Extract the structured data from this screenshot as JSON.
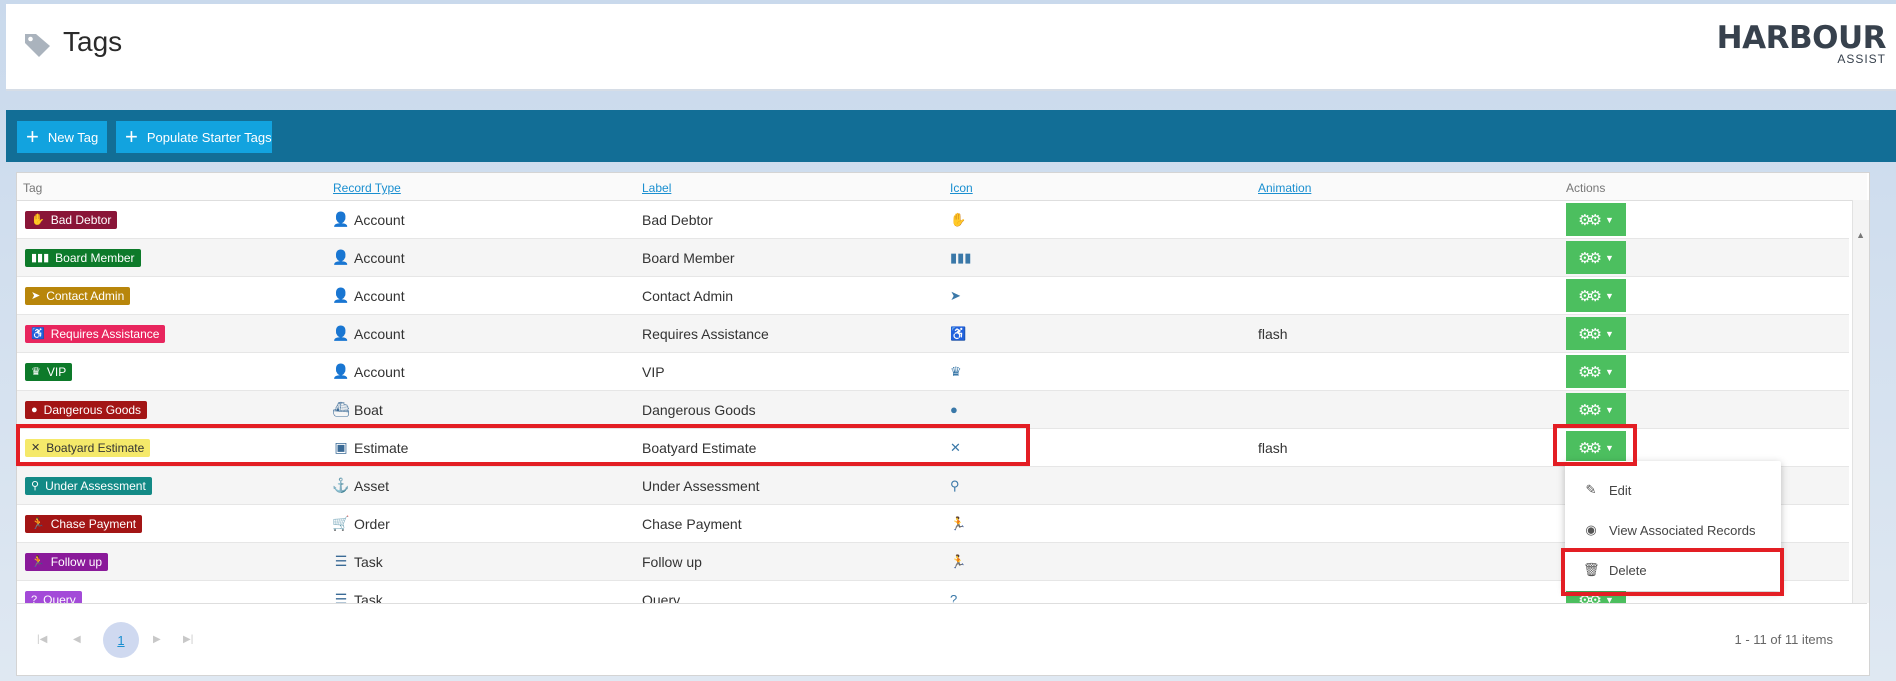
{
  "header": {
    "title": "Tags",
    "logo_main": "HARBOUR",
    "logo_sub": "ASSIST"
  },
  "toolbar": {
    "new_tag": "New Tag",
    "populate": "Populate Starter Tags"
  },
  "grid": {
    "columns": {
      "tag": "Tag",
      "record_type": "Record Type",
      "label": "Label",
      "icon": "Icon",
      "animation": "Animation",
      "actions": "Actions"
    },
    "rows": [
      {
        "tag": "Bad Debtor",
        "record_type": "Account",
        "label": "Bad Debtor",
        "animation": "",
        "color": "#8a1538",
        "icon": "hand-coin-icon"
      },
      {
        "tag": "Board Member",
        "record_type": "Account",
        "label": "Board Member",
        "animation": "",
        "color": "#0d7a2a",
        "icon": "group-icon"
      },
      {
        "tag": "Contact Admin",
        "record_type": "Account",
        "label": "Contact Admin",
        "animation": "",
        "color": "#b8860b",
        "icon": "telegram-icon"
      },
      {
        "tag": "Requires Assistance",
        "record_type": "Account",
        "label": "Requires Assistance",
        "animation": "flash",
        "color": "#e8265e",
        "icon": "wheelchair-icon"
      },
      {
        "tag": "VIP",
        "record_type": "Account",
        "label": "VIP",
        "animation": "",
        "color": "#0d7a2a",
        "icon": "crown-icon"
      },
      {
        "tag": "Dangerous Goods",
        "record_type": "Boat",
        "label": "Dangerous Goods",
        "animation": "",
        "color": "#a31515",
        "icon": "bomb-icon"
      },
      {
        "tag": "Boatyard Estimate",
        "record_type": "Estimate",
        "label": "Boatyard Estimate",
        "animation": "flash",
        "color": "#f5e96a",
        "icon": "tools-icon"
      },
      {
        "tag": "Under Assessment",
        "record_type": "Asset",
        "label": "Under Assessment",
        "animation": "",
        "color": "#138a86",
        "icon": "magnifier-icon"
      },
      {
        "tag": "Chase Payment",
        "record_type": "Order",
        "label": "Chase Payment",
        "animation": "",
        "color": "#a31515",
        "icon": "runner-icon"
      },
      {
        "tag": "Follow up",
        "record_type": "Task",
        "label": "Follow up",
        "animation": "",
        "color": "#8a1a9a",
        "icon": "runner-icon"
      },
      {
        "tag": "Query",
        "record_type": "Task",
        "label": "Query",
        "animation": "",
        "color": "#a34ad8",
        "icon": "question-icon"
      }
    ]
  },
  "pager": {
    "current_page": "1",
    "info": "1 - 11 of 11 items"
  },
  "menu": {
    "edit": "Edit",
    "view": "View Associated Records",
    "delete": "Delete"
  }
}
